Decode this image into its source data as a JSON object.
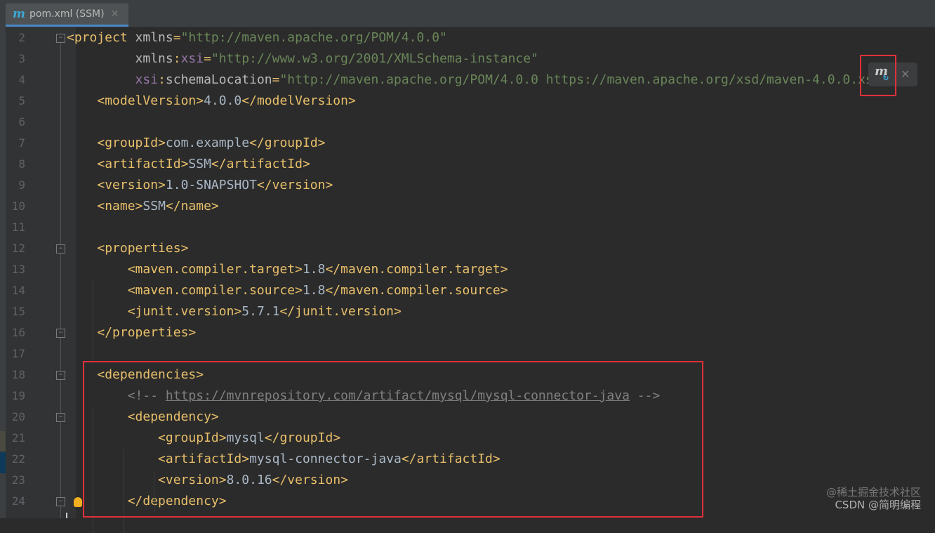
{
  "tab": {
    "title": "pom.xml (SSM)",
    "icon": "maven-icon"
  },
  "lines": [
    {
      "n": "2",
      "parts": [
        [
          "t",
          "<project "
        ],
        [
          "a",
          "xmlns"
        ],
        [
          "t",
          "="
        ],
        [
          "s",
          "\"http://maven.apache.org/POM/4.0.0\""
        ]
      ]
    },
    {
      "n": "3",
      "parts": [
        [
          "x",
          "         "
        ],
        [
          "a",
          "xmlns"
        ],
        [
          "t",
          ":"
        ],
        [
          "ns",
          "xsi"
        ],
        [
          "t",
          "="
        ],
        [
          "s",
          "\"http://www.w3.org/2001/XMLSchema-instance\""
        ]
      ]
    },
    {
      "n": "4",
      "parts": [
        [
          "x",
          "         "
        ],
        [
          "ns",
          "xsi"
        ],
        [
          "t",
          ":"
        ],
        [
          "a",
          "schemaLocation"
        ],
        [
          "t",
          "="
        ],
        [
          "s",
          "\"http://maven.apache.org/POM/4.0.0 https://maven.apache.org/xsd/maven-4.0.0.xsd\">"
        ]
      ]
    },
    {
      "n": "5",
      "parts": [
        [
          "x",
          "    "
        ],
        [
          "t",
          "<modelVersion>"
        ],
        [
          "x",
          "4.0.0"
        ],
        [
          "t",
          "</modelVersion>"
        ]
      ]
    },
    {
      "n": "6",
      "parts": []
    },
    {
      "n": "7",
      "parts": [
        [
          "x",
          "    "
        ],
        [
          "t",
          "<groupId>"
        ],
        [
          "x",
          "com.example"
        ],
        [
          "t",
          "</groupId>"
        ]
      ]
    },
    {
      "n": "8",
      "parts": [
        [
          "x",
          "    "
        ],
        [
          "t",
          "<artifactId>"
        ],
        [
          "x",
          "SSM"
        ],
        [
          "t",
          "</artifactId>"
        ]
      ]
    },
    {
      "n": "9",
      "parts": [
        [
          "x",
          "    "
        ],
        [
          "t",
          "<version>"
        ],
        [
          "x",
          "1.0-SNAPSHOT"
        ],
        [
          "t",
          "</version>"
        ]
      ]
    },
    {
      "n": "10",
      "parts": [
        [
          "x",
          "    "
        ],
        [
          "t",
          "<name>"
        ],
        [
          "x",
          "SSM"
        ],
        [
          "t",
          "</name>"
        ]
      ]
    },
    {
      "n": "11",
      "parts": []
    },
    {
      "n": "12",
      "parts": [
        [
          "x",
          "    "
        ],
        [
          "t",
          "<properties>"
        ]
      ]
    },
    {
      "n": "13",
      "parts": [
        [
          "x",
          "        "
        ],
        [
          "t",
          "<maven.compiler.target>"
        ],
        [
          "x",
          "1.8"
        ],
        [
          "t",
          "</maven.compiler.target>"
        ]
      ]
    },
    {
      "n": "14",
      "parts": [
        [
          "x",
          "        "
        ],
        [
          "t",
          "<maven.compiler.source>"
        ],
        [
          "x",
          "1.8"
        ],
        [
          "t",
          "</maven.compiler.source>"
        ]
      ]
    },
    {
      "n": "15",
      "parts": [
        [
          "x",
          "        "
        ],
        [
          "t",
          "<junit.version>"
        ],
        [
          "x",
          "5.7.1"
        ],
        [
          "t",
          "</junit.version>"
        ]
      ]
    },
    {
      "n": "16",
      "parts": [
        [
          "x",
          "    "
        ],
        [
          "t",
          "</properties>"
        ]
      ]
    },
    {
      "n": "17",
      "parts": []
    },
    {
      "n": "18",
      "parts": [
        [
          "x",
          "    "
        ],
        [
          "t",
          "<dependencies>"
        ]
      ]
    },
    {
      "n": "19",
      "parts": [
        [
          "x",
          "        "
        ],
        [
          "c",
          "<!-- "
        ],
        [
          "u",
          "https://mvnrepository.com/artifact/mysql/mysql-connector-java"
        ],
        [
          "c",
          " -->"
        ]
      ]
    },
    {
      "n": "20",
      "parts": [
        [
          "x",
          "        "
        ],
        [
          "t",
          "<dependency>"
        ]
      ]
    },
    {
      "n": "21",
      "parts": [
        [
          "x",
          "            "
        ],
        [
          "t",
          "<groupId>"
        ],
        [
          "x",
          "mysql"
        ],
        [
          "t",
          "</groupId>"
        ]
      ]
    },
    {
      "n": "22",
      "parts": [
        [
          "x",
          "            "
        ],
        [
          "t",
          "<artifactId>"
        ],
        [
          "x",
          "mysql-connector-java"
        ],
        [
          "t",
          "</artifactId>"
        ]
      ]
    },
    {
      "n": "23",
      "parts": [
        [
          "x",
          "            "
        ],
        [
          "t",
          "<version>"
        ],
        [
          "x",
          "8.0.16"
        ],
        [
          "t",
          "</version>"
        ]
      ]
    },
    {
      "n": "24",
      "parts": [
        [
          "x",
          "        "
        ],
        [
          "t",
          "</dependency>"
        ]
      ]
    }
  ],
  "folds": [
    "2",
    "12",
    "16",
    "18",
    "20",
    "24"
  ],
  "watermark": {
    "line1": "@稀土掘金技术社区",
    "line2": "CSDN @简明编程"
  },
  "colors": {
    "tag": "#e8bf6a",
    "string": "#6a8759",
    "highlight": "#e0303a"
  }
}
